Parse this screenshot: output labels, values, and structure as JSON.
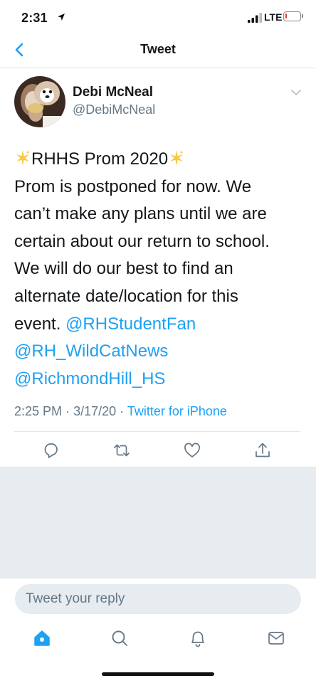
{
  "status_bar": {
    "time": "2:31",
    "network": "LTE",
    "battery_level": 0.12,
    "battery_color": "#e8342a"
  },
  "nav": {
    "title": "Tweet",
    "back_icon": "chevron-left-icon"
  },
  "tweet": {
    "author_name": "Debi McNeal",
    "author_handle": "@DebiMcNeal",
    "title": "RHHS Prom 2020",
    "text_line_1": "Prom is postponed for now. We",
    "text_line_2": "can’t make any plans until we are",
    "text_line_3": "certain about our return to school.",
    "text_line_4": "We will do our best to find an",
    "text_line_5": "alternate date/location for this",
    "text_line_6": "event.",
    "mentions": [
      "@RHStudentFan",
      "@RH_WildCatNews",
      "@RichmondHill_HS"
    ],
    "time": "2:25 PM",
    "date": "3/17/20",
    "separator": "·",
    "source": "Twitter for iPhone"
  },
  "actions": [
    "reply-icon",
    "retweet-icon",
    "like-icon",
    "share-icon"
  ],
  "reply": {
    "placeholder": "Tweet your reply"
  },
  "tabs": [
    "home-icon",
    "search-icon",
    "notifications-icon",
    "messages-icon"
  ],
  "colors": {
    "accent": "#1da1f2",
    "secondary_text": "#657786",
    "gray_background": "#e6ecf0"
  }
}
